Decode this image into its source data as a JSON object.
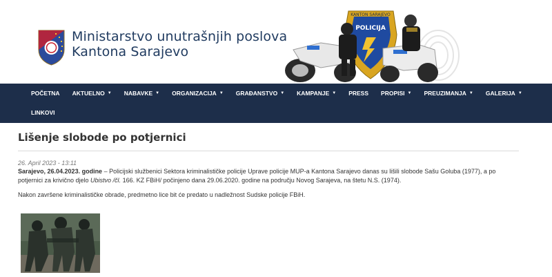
{
  "header": {
    "title_line1": "Ministarstvo unutrašnjih poslova",
    "title_line2": "Kantona Sarajevo",
    "banner_badge_line1": "KANTON SARAJEVO",
    "banner_badge_line2": "POLICIJA"
  },
  "nav": {
    "items": [
      {
        "label": "POČETNA",
        "dropdown": false
      },
      {
        "label": "AKTUELNO",
        "dropdown": true
      },
      {
        "label": "NABAVKE",
        "dropdown": true
      },
      {
        "label": "ORGANIZACIJA",
        "dropdown": true
      },
      {
        "label": "GRAĐANSTVO",
        "dropdown": true
      },
      {
        "label": "KAMPANJE",
        "dropdown": true
      },
      {
        "label": "PRESS",
        "dropdown": false
      },
      {
        "label": "PROPISI",
        "dropdown": true
      },
      {
        "label": "PREUZIMANJA",
        "dropdown": true
      },
      {
        "label": "GALERIJA",
        "dropdown": true
      },
      {
        "label": "LINKOVI",
        "dropdown": false
      }
    ],
    "caret": "▼"
  },
  "article": {
    "title": "Lišenje slobode po potjernici",
    "date": "26. April 2023 - 13:11",
    "lead_bold": "Sarajevo, 26.04.2023. godine",
    "lead_text1": " – Policijski službenici Sektora kriminalističke policije Uprave policije MUP-a Kantona Sarajevo danas su lišili slobode Sašu Goluba (1977), a po potjernici za krivično djelo ",
    "lead_italic": "Ubistvo /čl.",
    "lead_text2": " 166. KZ FBiH/ počinjeno dana 29.06.2020. godine na području Novog Sarajeva, na štetu N.S. (1974).",
    "para2": "Nakon završene kriminalističke obrade, predmetno lice bit će predato u nadležnost Sudske policije FBiH."
  },
  "colors": {
    "nav_bg": "#1d2e4a",
    "title_blue": "#1f3a5f",
    "shield_blue": "#2b4a9b",
    "shield_red": "#c8202f"
  }
}
